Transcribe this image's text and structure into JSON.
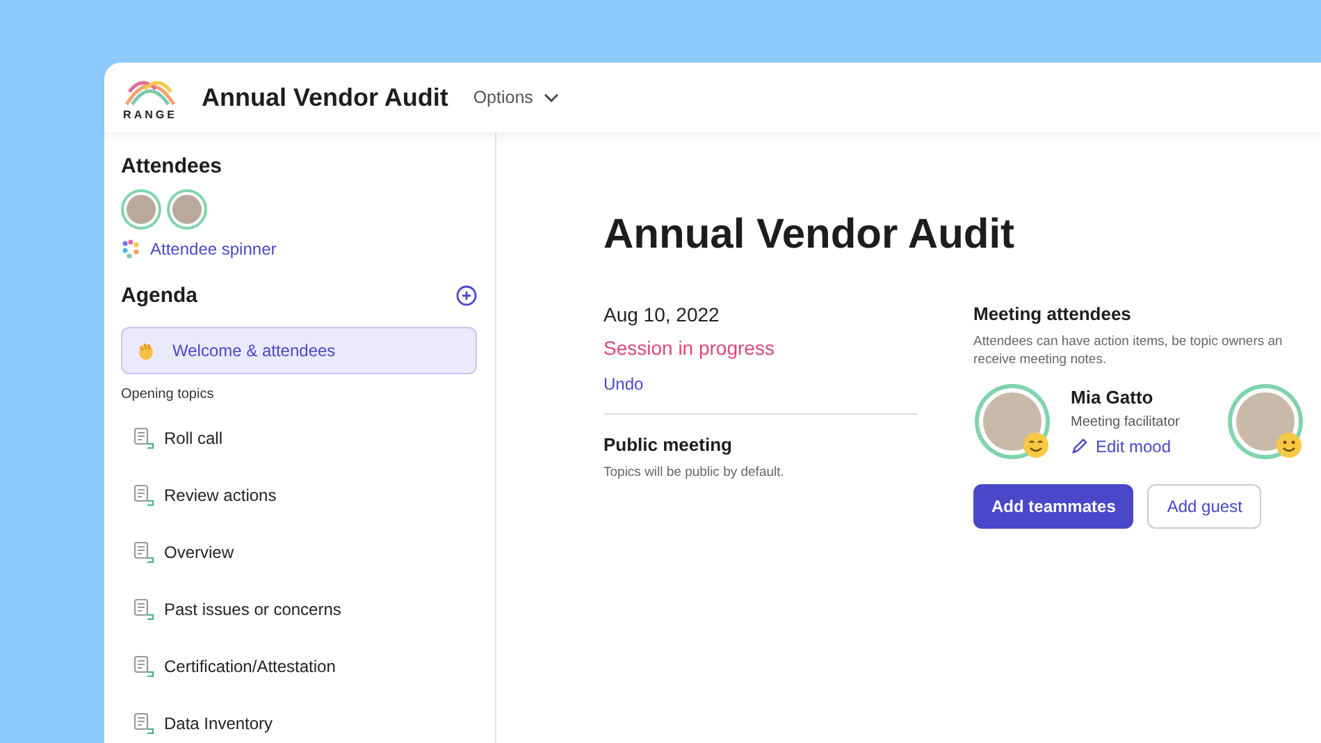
{
  "header": {
    "logo_text": "RANGE",
    "title": "Annual Vendor Audit",
    "options": "Options"
  },
  "sidebar": {
    "attendees_title": "Attendees",
    "spinner": "Attendee spinner",
    "agenda_title": "Agenda",
    "pinned": [
      {
        "label": "Welcome & attendees",
        "selected": true
      }
    ],
    "section_title": "Opening topics",
    "topics": [
      {
        "label": "Roll call",
        "selected": false
      },
      {
        "label": "Review actions",
        "selected": false
      },
      {
        "label": "Overview",
        "selected": false
      },
      {
        "label": "Past issues or concerns",
        "selected": false
      },
      {
        "label": "Certification/Attestation",
        "selected": false
      },
      {
        "label": "Data Inventory",
        "selected": false
      }
    ]
  },
  "main": {
    "title": "Annual Vendor Audit",
    "date": "Aug 10, 2022",
    "status": "Session in progress",
    "undo": "Undo",
    "visibility_title": "Public meeting",
    "visibility_note": "Topics will be public by default.",
    "attendees_title": "Meeting attendees",
    "attendees_note": "Attendees can have action items, be topic owners an receive meeting notes.",
    "facilitator": {
      "name": "Mia Gatto",
      "role": "Meeting facilitator",
      "action": "Edit mood"
    },
    "buttons": [
      {
        "label": "Add teammates",
        "kind": "primary"
      },
      {
        "label": "Add guest",
        "kind": "secondary"
      }
    ]
  }
}
